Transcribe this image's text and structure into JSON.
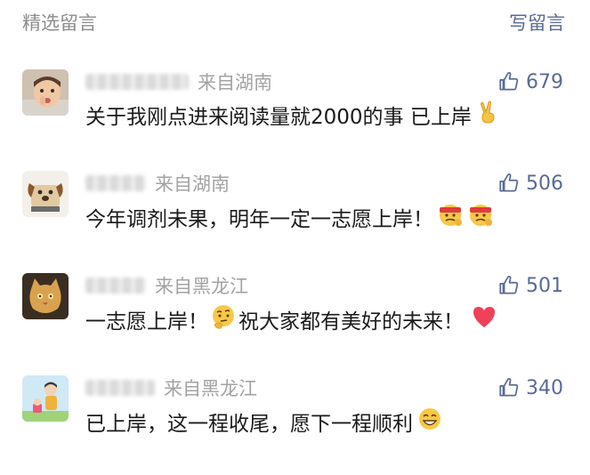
{
  "header": {
    "title": "精选留言",
    "write_label": "写留言"
  },
  "comments": [
    {
      "location": "来自湖南",
      "likes": "679",
      "text": "关于我刚点进来阅读量就2000的事 已上岸",
      "emojis": [
        "victory-hand-emoji"
      ]
    },
    {
      "location": "来自湖南",
      "likes": "506",
      "text": "今年调剂未果，明年一定一志愿上岸！",
      "emojis": [
        "determined-face-emoji",
        "determined-face-emoji"
      ]
    },
    {
      "location": "来自黑龙江",
      "likes": "501",
      "text_before": "一志愿上岸！",
      "text_after": "祝大家都有美好的未来！",
      "emojis": [
        "thinking-face-emoji",
        "red-heart-emoji"
      ]
    },
    {
      "location": "来自黑龙江",
      "likes": "340",
      "text": "已上岸，这一程收尾，愿下一程顺利",
      "emojis": [
        "grinning-face-emoji"
      ]
    }
  ],
  "colors": {
    "link": "#576b95",
    "muted": "#a3a3a3",
    "text": "#1a1a1a"
  }
}
